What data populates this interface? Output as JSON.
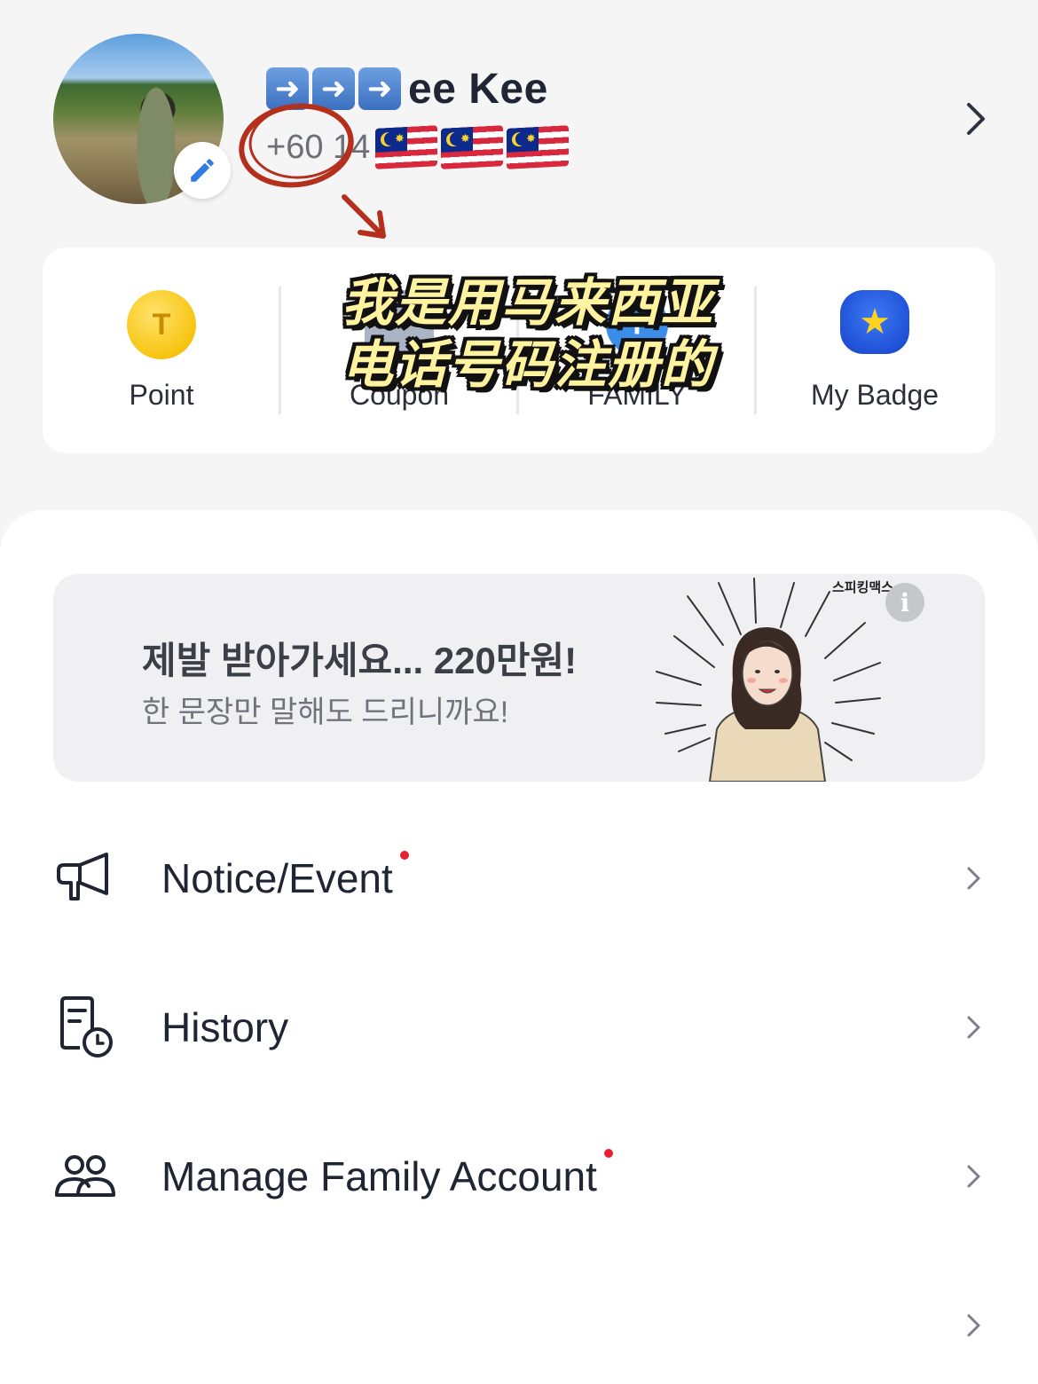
{
  "profile": {
    "name_prefix_icons": [
      "arrow-right-emoji",
      "arrow-right-emoji",
      "arrow-right-emoji"
    ],
    "name": "ee Kee",
    "phone_partial": "+60 14",
    "flags": [
      "malaysia-flag",
      "malaysia-flag",
      "malaysia-flag"
    ]
  },
  "quick_menu": [
    {
      "label": "Point",
      "icon": "point-coin-icon",
      "icon_glyph": "T"
    },
    {
      "label": "Coupon",
      "icon": "coupon-icon"
    },
    {
      "label": "FAMILY",
      "icon": "family-plus-icon",
      "icon_glyph": "+"
    },
    {
      "label": "My Badge",
      "icon": "badge-star-icon",
      "icon_glyph": "★"
    }
  ],
  "overlay_caption": [
    "我是用马来西亚",
    "电话号码注册的"
  ],
  "ad": {
    "title": "제발 받아가세요... 220만원!",
    "subtitle": "한 문장만 말해도 드리니까요!",
    "brand": "스피킹맥스",
    "info_glyph": "i"
  },
  "menu": [
    {
      "label": "Notice/Event",
      "icon": "megaphone-icon",
      "has_dot": true
    },
    {
      "label": "History",
      "icon": "history-document-icon",
      "has_dot": false
    },
    {
      "label": "Manage Family Account",
      "icon": "family-people-icon",
      "has_dot": true
    },
    {
      "label": "",
      "icon": "",
      "has_dot": false
    }
  ],
  "colors": {
    "background": "#f5f5f6",
    "card": "#ffffff",
    "text_primary": "#1f2533",
    "text_secondary": "#6b6f78",
    "notification_dot": "#e8202f",
    "annotation_red": "#b5301c",
    "caption_yellow": "#fff3a0"
  }
}
